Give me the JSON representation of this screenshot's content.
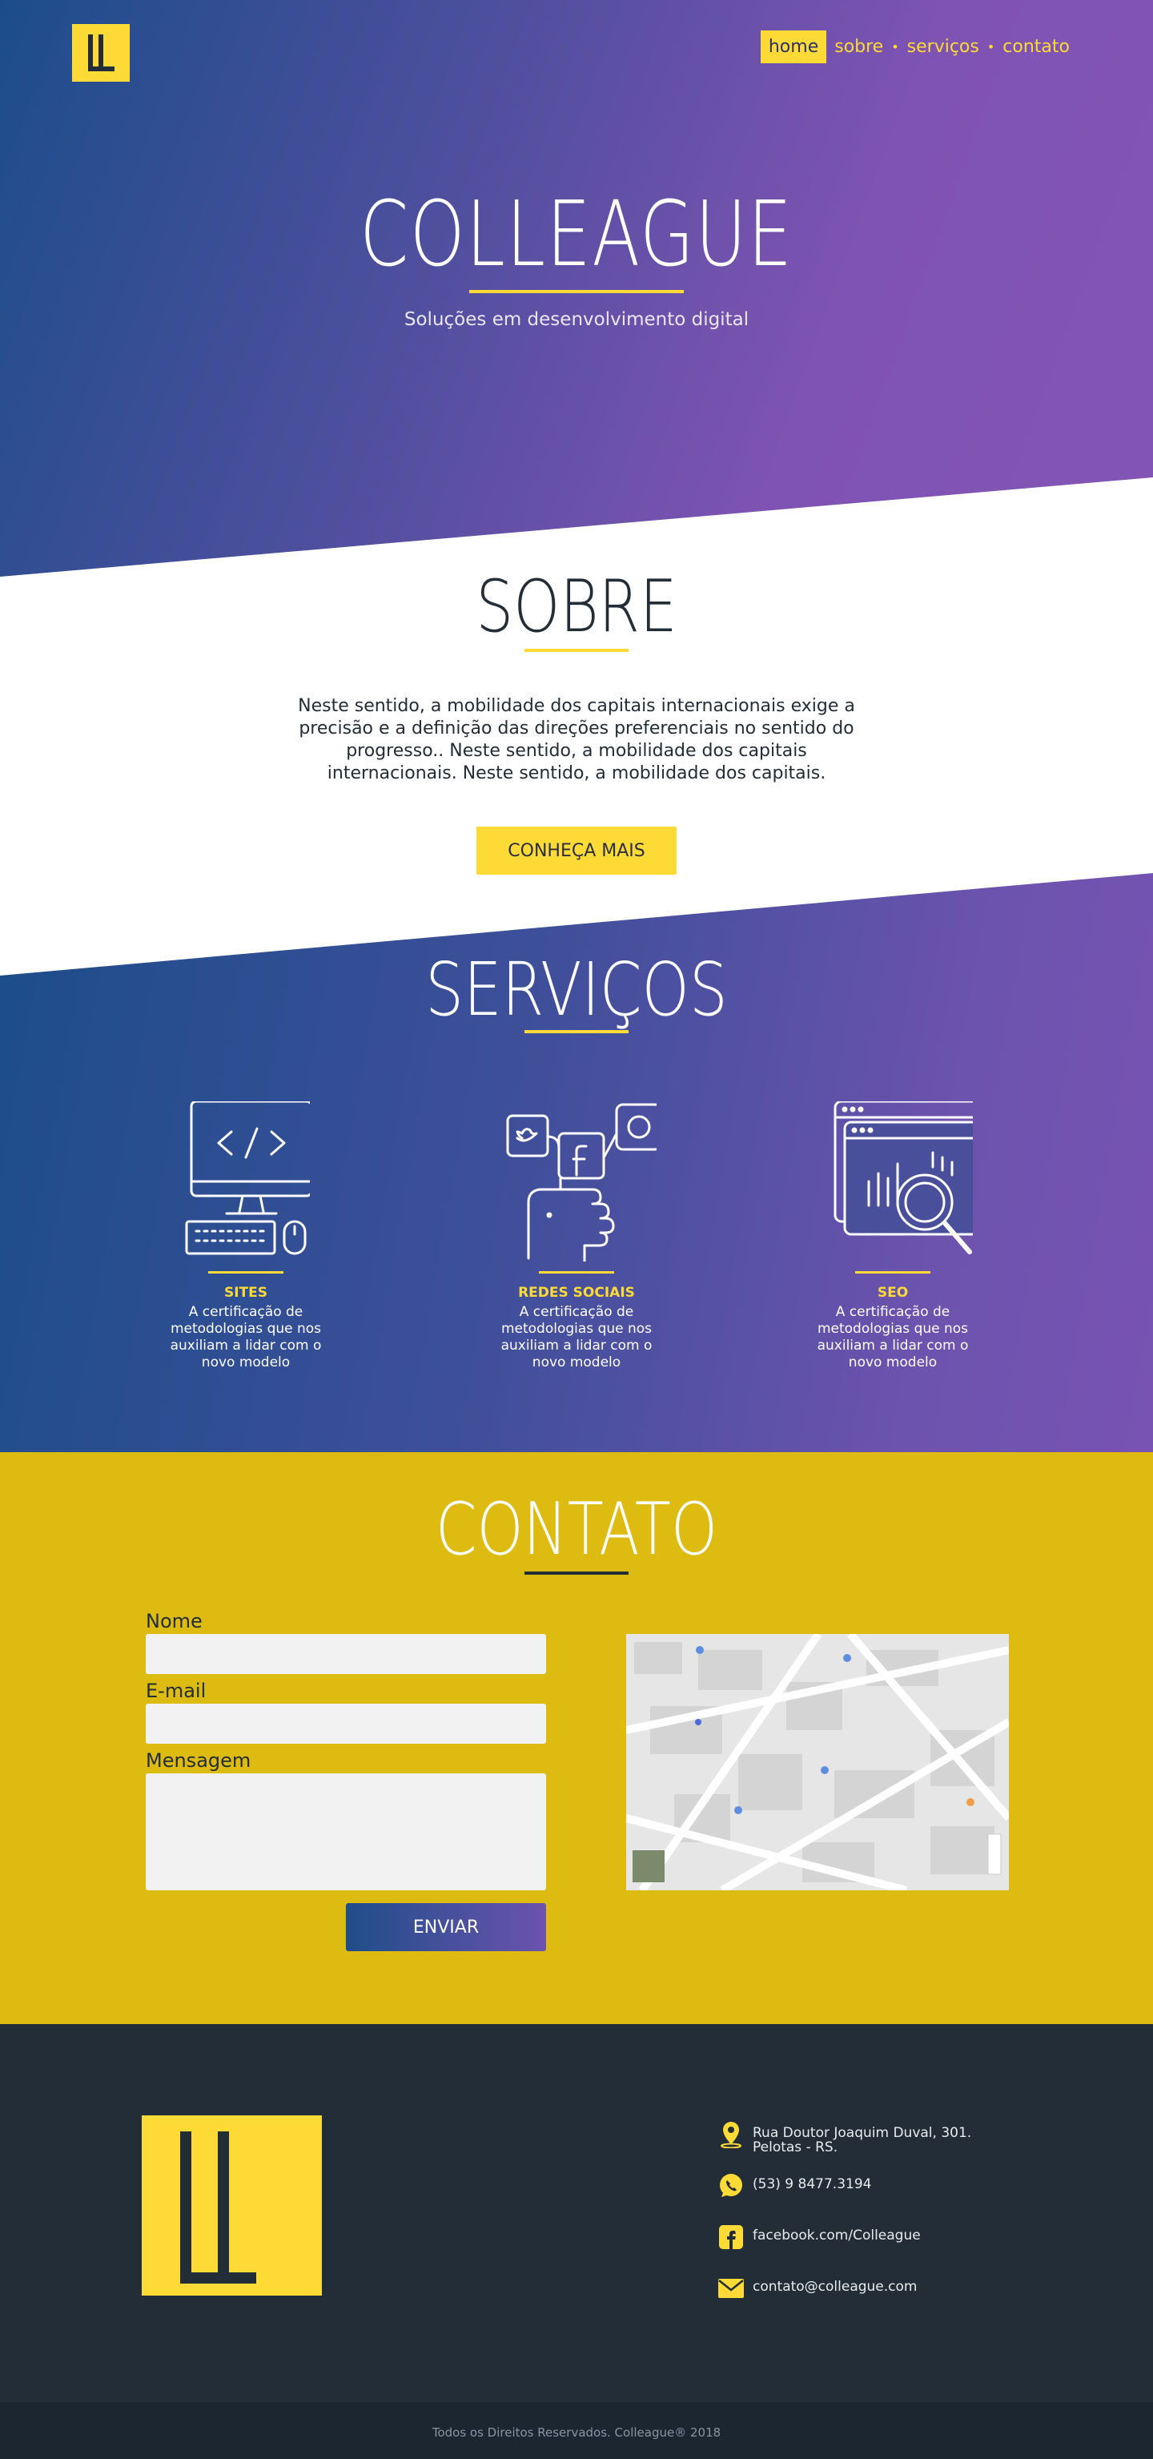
{
  "nav": {
    "logo": "LL",
    "items": [
      {
        "label": "home",
        "active": true
      },
      {
        "label": "sobre"
      },
      {
        "label": "serviços"
      },
      {
        "label": "contato"
      }
    ],
    "separator": "•"
  },
  "hero": {
    "title": "COLLEAGUE",
    "subtitle": "Soluções em desenvolvimento digital"
  },
  "sobre": {
    "title": "SOBRE",
    "text": "Neste sentido, a mobilidade dos capitais internacionais exige a precisão e a definição das direções preferenciais no sentido do progresso.. Neste sentido, a mobilidade dos capitais internacionais. Neste sentido, a mobilidade dos capitais.",
    "button": "CONHEÇA MAIS"
  },
  "servicos": {
    "title": "SERVIÇOS",
    "items": [
      {
        "title": "SITES",
        "desc": "A certificação de metodologias que nos auxiliam a lidar com o novo modelo",
        "icon": "computer-code-icon"
      },
      {
        "title": "REDES SOCIAIS",
        "desc": "A certificação de metodologias que nos auxiliam a lidar com o novo modelo",
        "icon": "social-media-hand-icon"
      },
      {
        "title": "SEO",
        "desc": "A certificação de metodologias que nos auxiliam a lidar com o novo modelo",
        "icon": "seo-magnifier-icon"
      }
    ]
  },
  "contato": {
    "title": "CONTATO",
    "labels": {
      "nome": "Nome",
      "email": "E-mail",
      "mensagem": "Mensagem"
    },
    "button": "ENVIAR"
  },
  "footer": {
    "address": "Rua Doutor Joaquim Duval, 301. Pelotas - RS.",
    "phone": "(53) 9 8477.3194",
    "facebook": "facebook.com/Colleague",
    "email": "contato@colleague.com",
    "copyright": "Todos os Direitos Reservados. Colleague® 2018"
  },
  "colors": {
    "accent": "#fdda35",
    "dark": "#222d37",
    "gradient_start": "#1c4d8a",
    "gradient_end": "#8355b5",
    "contact_bg": "#debb10"
  }
}
